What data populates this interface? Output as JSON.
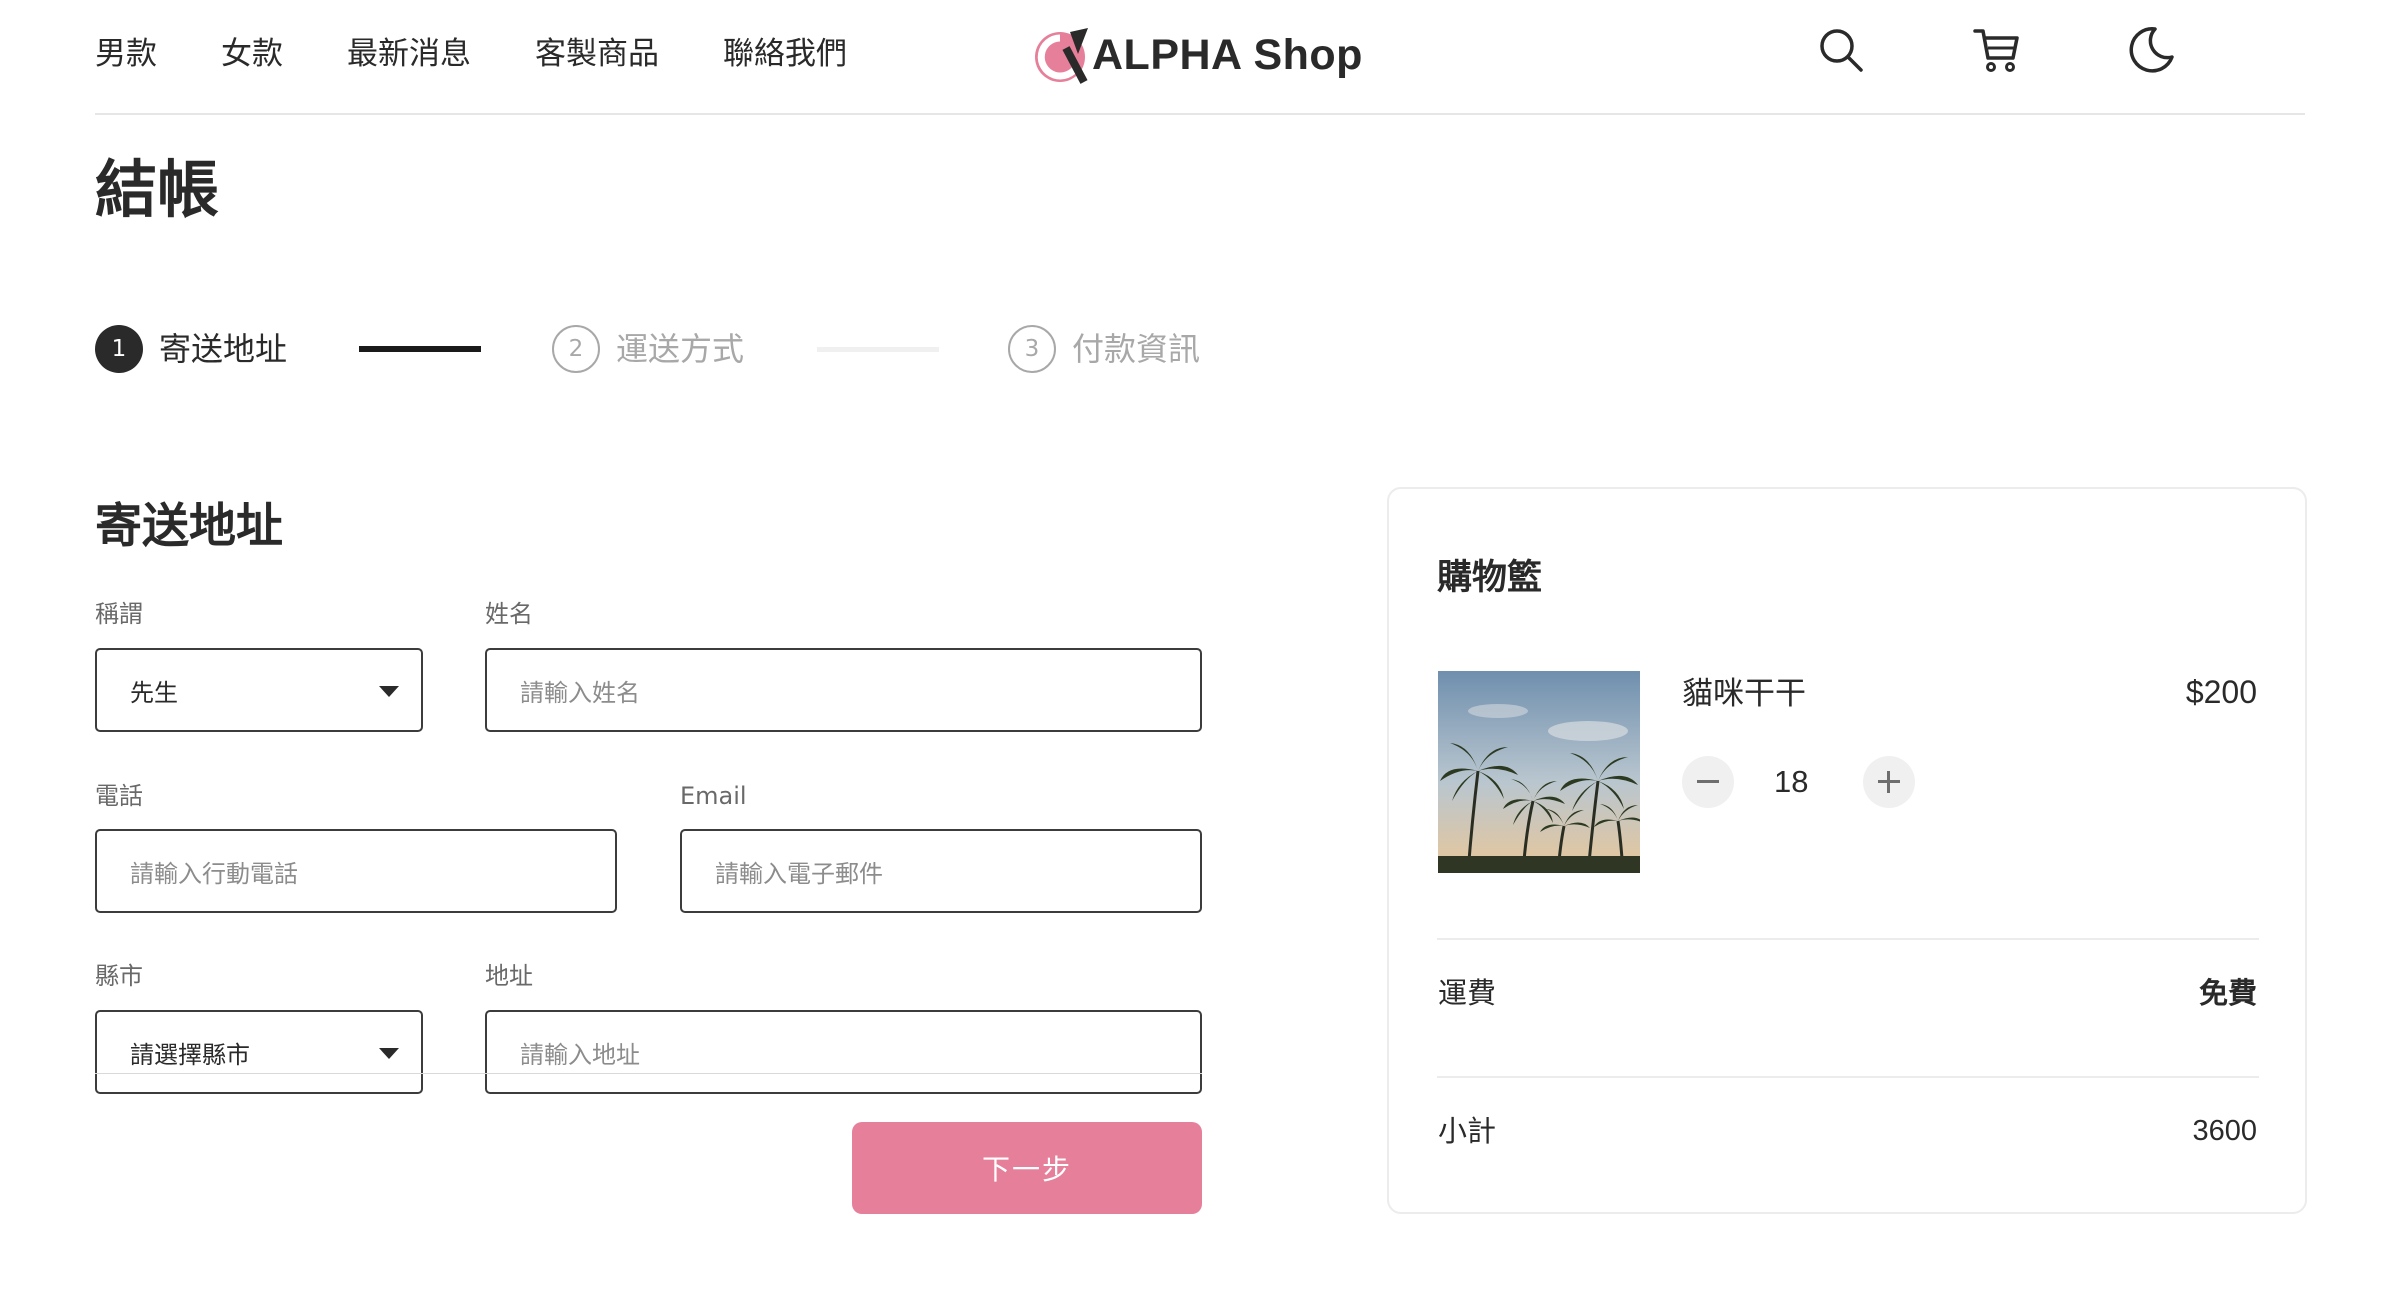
{
  "header": {
    "nav": [
      "男款",
      "女款",
      "最新消息",
      "客製商品",
      "聯絡我們"
    ],
    "logo_text": "ALPHA Shop",
    "logo_color": "#e67f9a",
    "icons": [
      "search-icon",
      "cart-icon",
      "moon-icon"
    ]
  },
  "page": {
    "title": "結帳"
  },
  "stepper": {
    "steps": [
      {
        "number": "1",
        "label": "寄送地址",
        "state": "active"
      },
      {
        "number": "2",
        "label": "運送方式",
        "state": "todo"
      },
      {
        "number": "3",
        "label": "付款資訊",
        "state": "todo"
      }
    ]
  },
  "form": {
    "section_title": "寄送地址",
    "salutation": {
      "label": "稱謂",
      "value": "先生"
    },
    "name": {
      "label": "姓名",
      "placeholder": "請輸入姓名"
    },
    "phone": {
      "label": "電話",
      "placeholder": "請輸入行動電話"
    },
    "email": {
      "label": "Email",
      "placeholder": "請輸入電子郵件"
    },
    "city": {
      "label": "縣市",
      "value": "請選擇縣市"
    },
    "address": {
      "label": "地址",
      "placeholder": "請輸入地址"
    },
    "next_button": "下一步"
  },
  "cart": {
    "title": "購物籃",
    "item": {
      "name": "貓咪干干",
      "price": "$200",
      "quantity": "18",
      "image": "palm-trees-photo"
    },
    "shipping": {
      "label": "運費",
      "value": "免費"
    },
    "subtotal": {
      "label": "小計",
      "value": "3600"
    }
  },
  "colors": {
    "accent": "#e67f9a",
    "text": "#2a2a2a",
    "muted": "#a8a8a8"
  }
}
